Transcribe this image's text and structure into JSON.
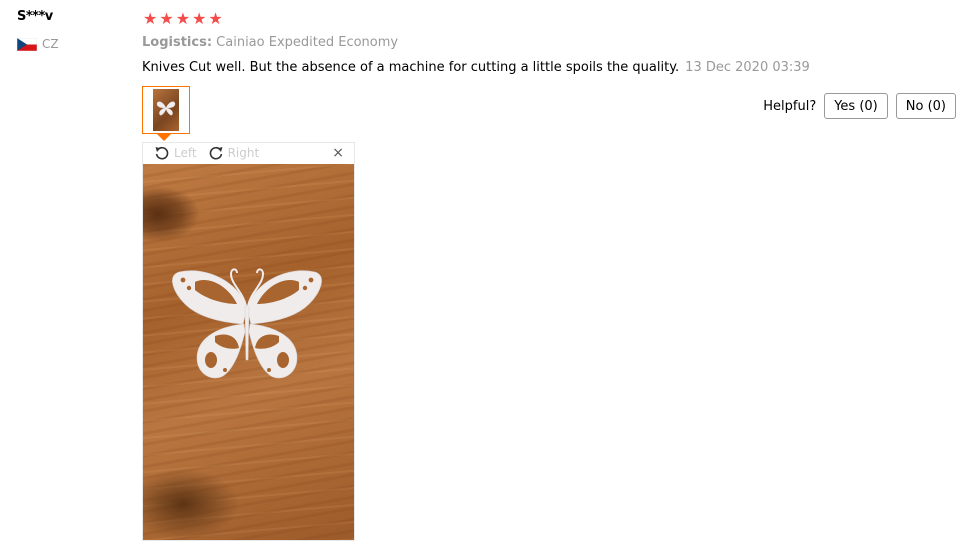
{
  "reviewer": {
    "name": "S***v",
    "country_code": "CZ",
    "rating": 5
  },
  "review": {
    "logistics_label": "Logistics:",
    "logistics_value": "Cainiao Expedited Economy",
    "text": "Knives Cut well. But the absence of a machine for cutting a little spoils the quality.",
    "date": "13 Dec 2020 03:39"
  },
  "helpful": {
    "label": "Helpful?",
    "yes_label": "Yes (0)",
    "no_label": "No (0)"
  },
  "viewer": {
    "rotate_left_label": "Left",
    "rotate_right_label": "Right",
    "close_glyph": "×"
  },
  "icons": {
    "flag": "czech-flag-icon",
    "star": "star-icon",
    "rotate_left": "rotate-left-icon",
    "rotate_right": "rotate-right-icon",
    "close": "close-icon"
  },
  "colors": {
    "star": "#f44b4b",
    "thumb_border": "#ff7300",
    "muted_text": "#999999"
  }
}
